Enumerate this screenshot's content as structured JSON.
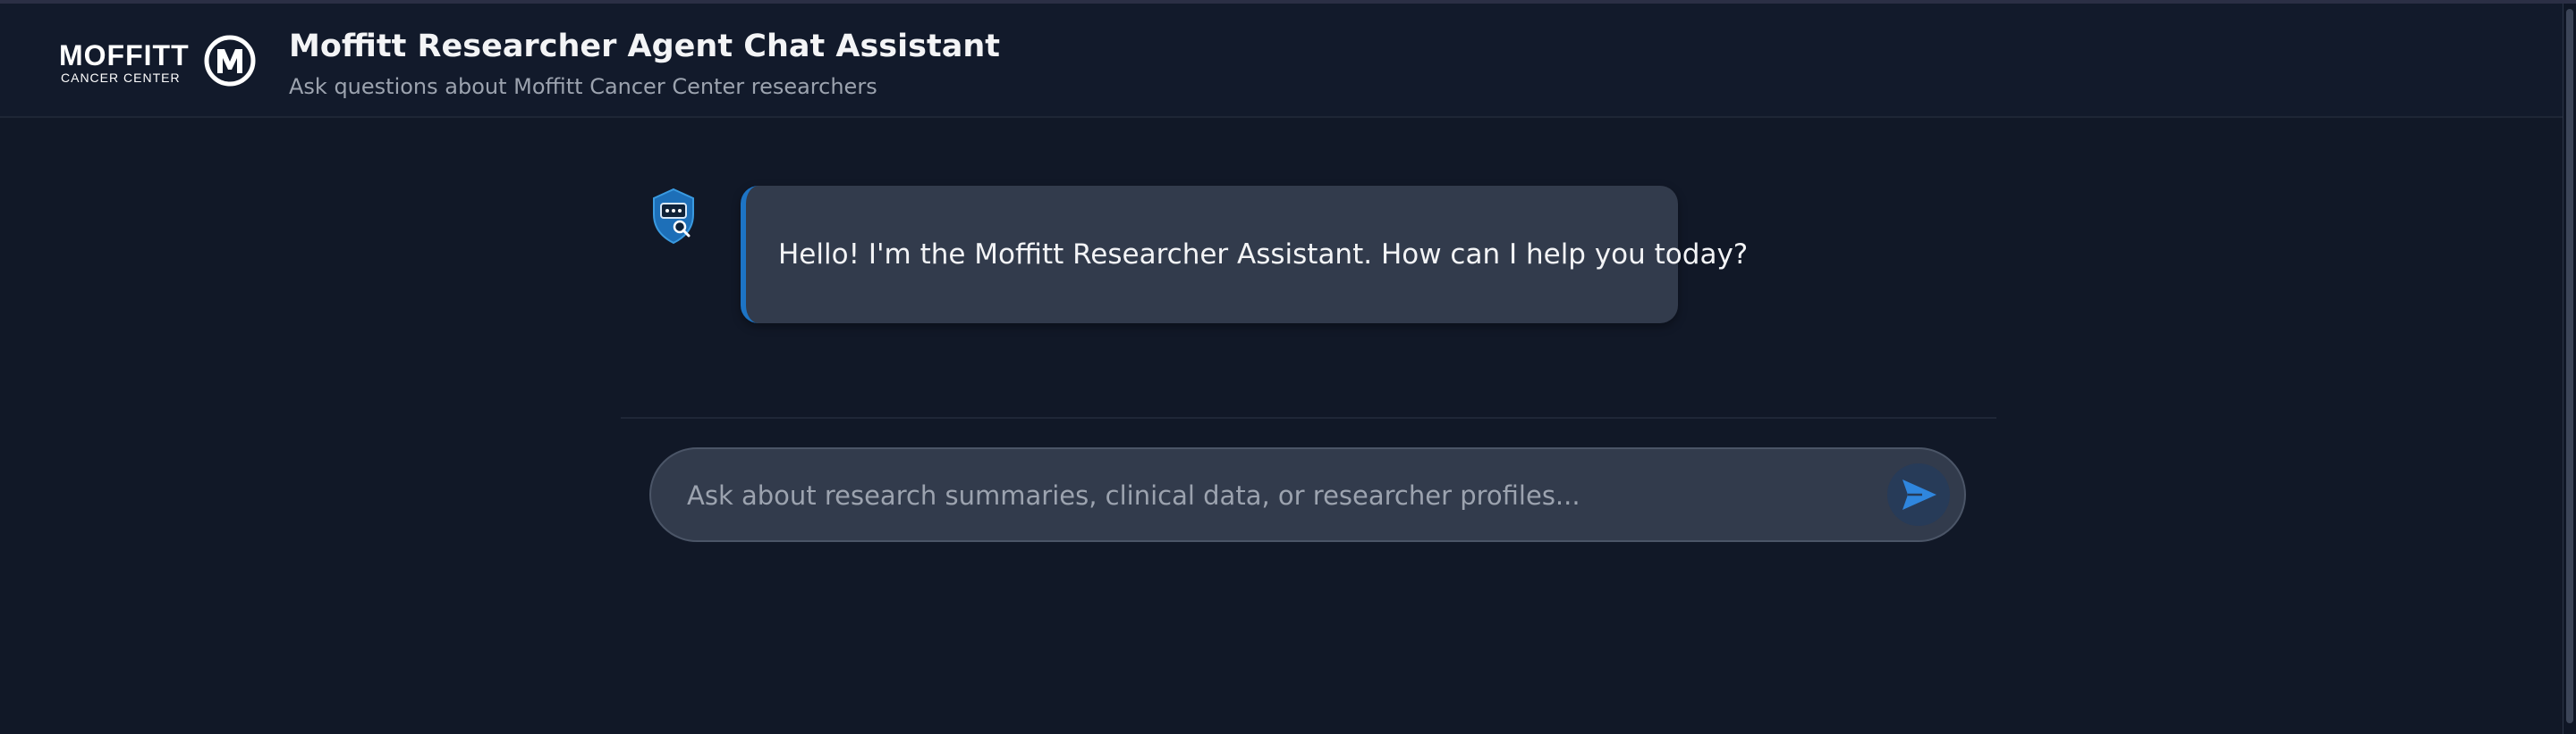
{
  "header": {
    "logo": {
      "wordmark": "MOFFITT",
      "subtext": "CANCER CENTER"
    },
    "title": "Moffitt Researcher Agent Chat Assistant",
    "subtitle": "Ask questions about Moffitt Cancer Center researchers"
  },
  "chat": {
    "messages": [
      {
        "role": "assistant",
        "avatar_icon": "shield-search-icon",
        "text": "Hello! I'm the Moffitt Researcher Assistant. How can I help you today?"
      }
    ]
  },
  "composer": {
    "value": "",
    "placeholder": "Ask about research summaries, clinical data, or researcher profiles...",
    "send_icon": "send-icon"
  },
  "colors": {
    "background": "#111827",
    "header_background": "#121a2b",
    "bubble_background": "#323b4c",
    "accent": "#1d74c5",
    "muted_text": "#9ca3af"
  }
}
